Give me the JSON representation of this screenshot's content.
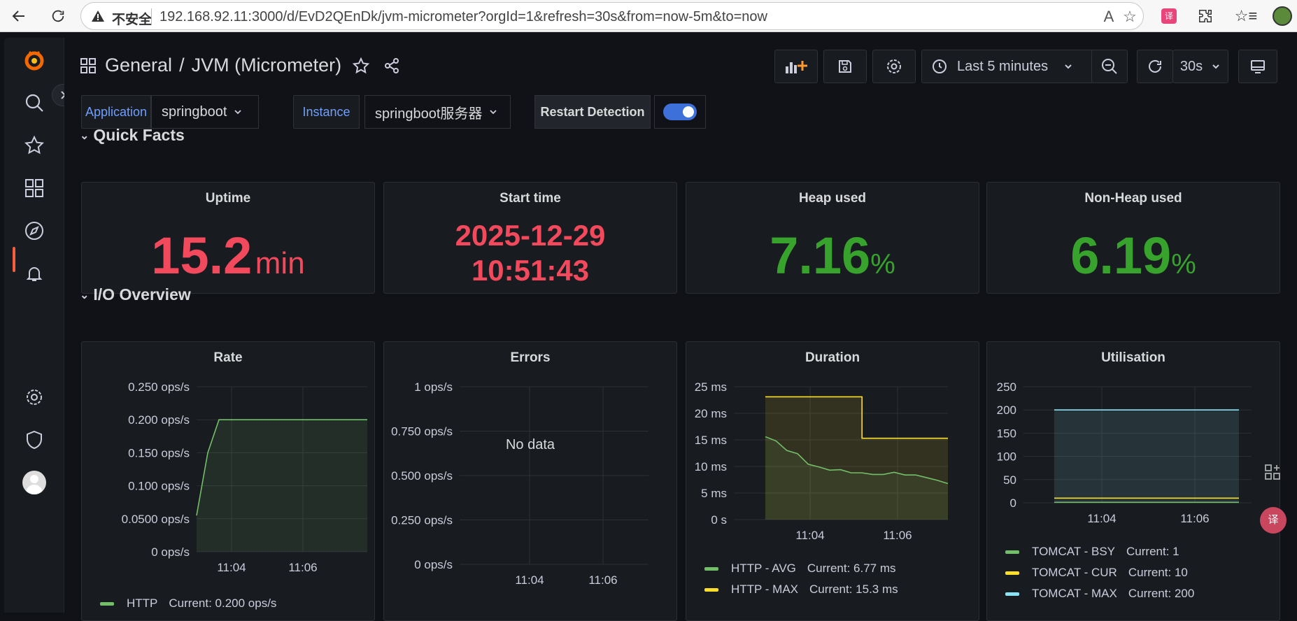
{
  "browser": {
    "insecure_label": "不安全",
    "url": "192.168.92.11:3000/d/EvD2QEnDk/jvm-micrometer?orgId=1&refresh=30s&from=now-5m&to=now"
  },
  "header": {
    "section": "General",
    "separator": "/",
    "title": "JVM (Micrometer)",
    "time_range": "Last 5 minutes",
    "refresh_interval": "30s"
  },
  "variables": {
    "application_label": "Application",
    "application_value": "springboot",
    "instance_label": "Instance",
    "instance_value": "springboot服务器",
    "restart_label": "Restart Detection",
    "restart_enabled": true
  },
  "rows": {
    "quick_facts": "Quick Facts",
    "io_overview": "I/O Overview"
  },
  "stats": [
    {
      "title": "Uptime",
      "value": "15.2",
      "unit": "min",
      "color": "#f2495c"
    },
    {
      "title": "Start time",
      "line1": "2025-12-29",
      "line2": "10:51:43",
      "color": "#f2495c"
    },
    {
      "title": "Heap used",
      "value": "7.16",
      "unit": "%",
      "color": "#37a32d"
    },
    {
      "title": "Non-Heap used",
      "value": "6.19",
      "unit": "%",
      "color": "#37a32d"
    }
  ],
  "colors": {
    "green": "#73bf69",
    "yellow": "#fade2a",
    "cyan": "#8ae3f5",
    "red": "#f2495c",
    "accent": "#3d71d9"
  },
  "panels": {
    "rate": {
      "title": "Rate",
      "legend": [
        {
          "name": "HTTP",
          "current": "Current: 0.200 ops/s"
        }
      ]
    },
    "errors": {
      "title": "Errors",
      "no_data": "No data"
    },
    "duration": {
      "title": "Duration",
      "legend": [
        {
          "name": "HTTP - AVG",
          "current": "Current: 6.77 ms"
        },
        {
          "name": "HTTP - MAX",
          "current": "Current: 15.3 ms"
        }
      ]
    },
    "utilisation": {
      "title": "Utilisation",
      "legend": [
        {
          "name": "TOMCAT - BSY",
          "current": "Current: 1"
        },
        {
          "name": "TOMCAT - CUR",
          "current": "Current: 10"
        },
        {
          "name": "TOMCAT - MAX",
          "current": "Current: 200"
        }
      ]
    }
  },
  "chart_data": [
    {
      "type": "line",
      "title": "Rate",
      "x": [
        "11:02:30",
        "11:03",
        "11:03:30",
        "11:04",
        "11:04:30",
        "11:05",
        "11:05:30",
        "11:06",
        "11:06:30",
        "11:07"
      ],
      "xticks": [
        "11:04",
        "11:06"
      ],
      "yticks": [
        "0 ops/s",
        "0.0500 ops/s",
        "0.100 ops/s",
        "0.150 ops/s",
        "0.200 ops/s",
        "0.250 ops/s"
      ],
      "ylim": [
        0,
        0.25
      ],
      "series": [
        {
          "name": "HTTP",
          "values": [
            0.055,
            0.15,
            0.2,
            0.2,
            0.2,
            0.2,
            0.2,
            0.2,
            0.2,
            0.2
          ]
        }
      ]
    },
    {
      "type": "line",
      "title": "Errors",
      "xticks": [
        "11:04",
        "11:06"
      ],
      "yticks": [
        "0 ops/s",
        "0.250 ops/s",
        "0.500 ops/s",
        "0.750 ops/s",
        "1 ops/s"
      ],
      "ylim": [
        0,
        1
      ],
      "series": []
    },
    {
      "type": "area",
      "title": "Duration",
      "xticks": [
        "11:04",
        "11:06"
      ],
      "yticks": [
        "0 s",
        "5 ms",
        "10 ms",
        "15 ms",
        "20 ms",
        "25 ms"
      ],
      "ylim": [
        0,
        25
      ],
      "series": [
        {
          "name": "HTTP - AVG",
          "values": [
            15.6,
            14.8,
            13.0,
            12.4,
            10.4,
            9.9,
            9.3,
            9.4,
            8.8,
            8.8,
            8.5,
            8.5,
            8.9,
            8.4,
            8.4,
            7.9,
            7.4,
            6.77
          ]
        },
        {
          "name": "HTTP - MAX",
          "values": [
            23.1,
            23.1,
            23.1,
            23.1,
            23.1,
            23.1,
            23.1,
            23.1,
            23.1,
            15.3,
            15.3,
            15.3,
            15.3,
            15.3,
            15.3,
            15.3,
            15.3,
            15.3
          ]
        }
      ]
    },
    {
      "type": "area",
      "title": "Utilisation",
      "xticks": [
        "11:04",
        "11:06"
      ],
      "yticks": [
        "0",
        "50",
        "100",
        "150",
        "200",
        "250"
      ],
      "ylim": [
        0,
        250
      ],
      "series": [
        {
          "name": "TOMCAT - BSY",
          "values": [
            1,
            1
          ]
        },
        {
          "name": "TOMCAT - CUR",
          "values": [
            10,
            10
          ]
        },
        {
          "name": "TOMCAT - MAX",
          "values": [
            200,
            200
          ]
        }
      ]
    }
  ]
}
